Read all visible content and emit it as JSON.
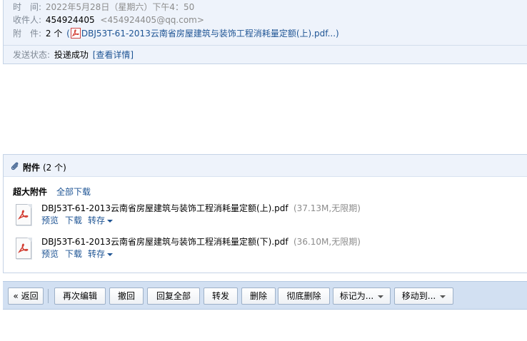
{
  "header": {
    "time_label": "时　间:",
    "time_value": "2022年5月28日（星期六）下午4：50",
    "recipient_label": "收件人:",
    "recipient_name": "454924405",
    "recipient_email": "<454924405@qq.com>",
    "attachment_label": "附　件:",
    "attachment_count": "2 个",
    "attachment_open": "(",
    "attachment_preview": "DBJ53T-61-2013云南省房屋建筑与装饰工程消耗量定额(上).pdf...",
    "attachment_close": ")",
    "status_label": "发送状态:",
    "status_value": "投递成功",
    "status_detail_link": "[查看详情]"
  },
  "attachments": {
    "title": "附件",
    "count_text": "(2 个)",
    "section_label": "超大附件",
    "download_all": "全部下载",
    "files": [
      {
        "name": "DBJ53T-61-2013云南省房屋建筑与装饰工程消耗量定额(上).pdf",
        "meta": "(37.13M,无限期)",
        "preview": "预览",
        "download": "下载",
        "save_to": "转存"
      },
      {
        "name": "DBJ53T-61-2013云南省房屋建筑与装饰工程消耗量定额(下).pdf",
        "meta": "(36.10M,无限期)",
        "preview": "预览",
        "download": "下载",
        "save_to": "转存"
      }
    ]
  },
  "toolbar": {
    "back": "« 返回",
    "edit_again": "再次编辑",
    "recall": "撤回",
    "reply_all": "回复全部",
    "forward": "转发",
    "delete": "删除",
    "delete_permanently": "彻底删除",
    "mark_as": "标记为...",
    "move_to": "移动到..."
  },
  "icons": {
    "pdf": "pdf-file-icon",
    "paperclip": "paperclip-icon",
    "dropdown": "chevron-down-icon"
  },
  "colors": {
    "link": "#1e5494",
    "pdf_red": "#d23a2f",
    "header_bg": "#eef3fb",
    "toolbar_bg": "#d2e0f2"
  }
}
